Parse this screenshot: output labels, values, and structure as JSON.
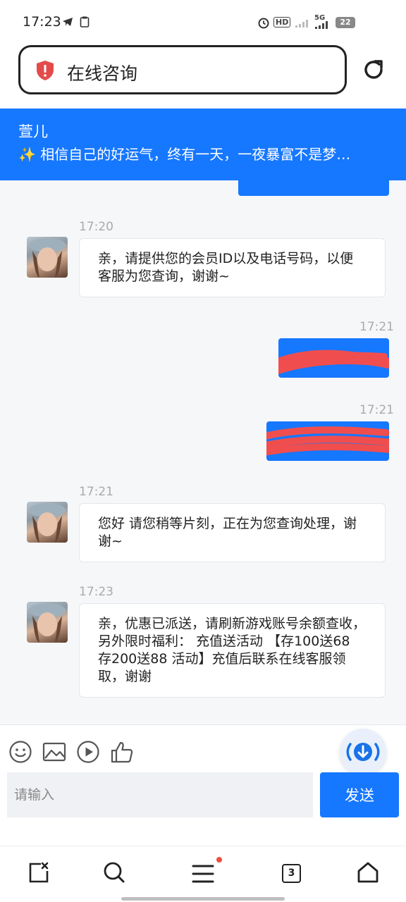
{
  "status_bar": {
    "time": "17:23",
    "hd_label": "HD",
    "network_label": "5G",
    "battery_level": "22"
  },
  "browser": {
    "url_title": "在线咨询"
  },
  "chat": {
    "agent_name": "萱儿",
    "agent_signature": "✨ 相信自己的好运气，终有一天，一夜暴富不是梦…"
  },
  "messages": [
    {
      "direction": "incoming",
      "time": "17:20",
      "text": "亲，请提供您的会员ID以及电话号码，以便客服为您查询，谢谢~"
    },
    {
      "direction": "outgoing",
      "time": "17:21",
      "text": ""
    },
    {
      "direction": "outgoing",
      "time": "17:21",
      "text": ""
    },
    {
      "direction": "incoming",
      "time": "17:21",
      "text": "您好 请您稍等片刻，正在为您查询处理，谢谢~"
    },
    {
      "direction": "incoming",
      "time": "17:23",
      "text": "亲，优惠已派送，请刷新游戏账号余额查收，另外限时福利： 充值送活动 【存100送68 存200送88 活动】充值后联系在线客服领取，谢谢"
    }
  ],
  "composer": {
    "placeholder": "请输入",
    "send_label": "发送",
    "tools": [
      "smile-icon",
      "image-icon",
      "play-icon",
      "thumbs-up-icon"
    ]
  },
  "bottom_nav": {
    "tab_count": "3",
    "items": [
      "close-tab-icon",
      "search-icon",
      "menu-icon",
      "tabs-icon",
      "home-icon"
    ]
  },
  "colors": {
    "accent": "#1677ff",
    "background": "#f6f7f9",
    "notification_dot": "#f04e3e",
    "redaction": "#f04e4e"
  }
}
